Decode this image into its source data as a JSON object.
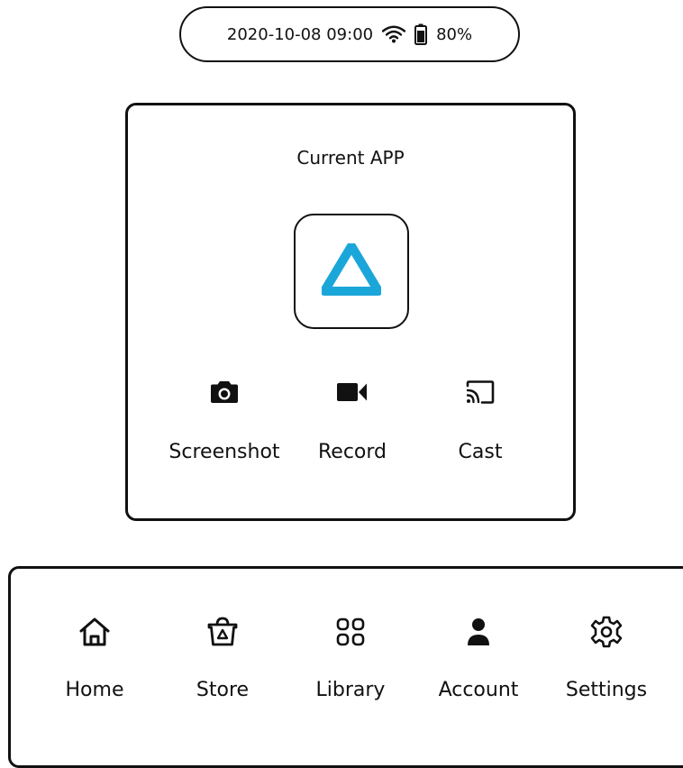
{
  "status_bar": {
    "datetime": "2020-10-08  09:00",
    "battery": "80%",
    "icons": [
      "wifi-icon",
      "battery-icon"
    ]
  },
  "current_app": {
    "title": "Current APP",
    "app_icon": "vive-logo-icon",
    "accent_color": "#1ba6d9",
    "actions": [
      {
        "label": "Screenshot",
        "icon": "camera-icon"
      },
      {
        "label": "Record",
        "icon": "video-camera-icon"
      },
      {
        "label": "Cast",
        "icon": "cast-icon"
      }
    ]
  },
  "nav": {
    "items": [
      {
        "label": "Home",
        "icon": "home-icon"
      },
      {
        "label": "Store",
        "icon": "store-bag-icon"
      },
      {
        "label": "Library",
        "icon": "library-grid-icon"
      },
      {
        "label": "Account",
        "icon": "account-person-icon"
      },
      {
        "label": "Settings",
        "icon": "gear-icon"
      }
    ]
  }
}
